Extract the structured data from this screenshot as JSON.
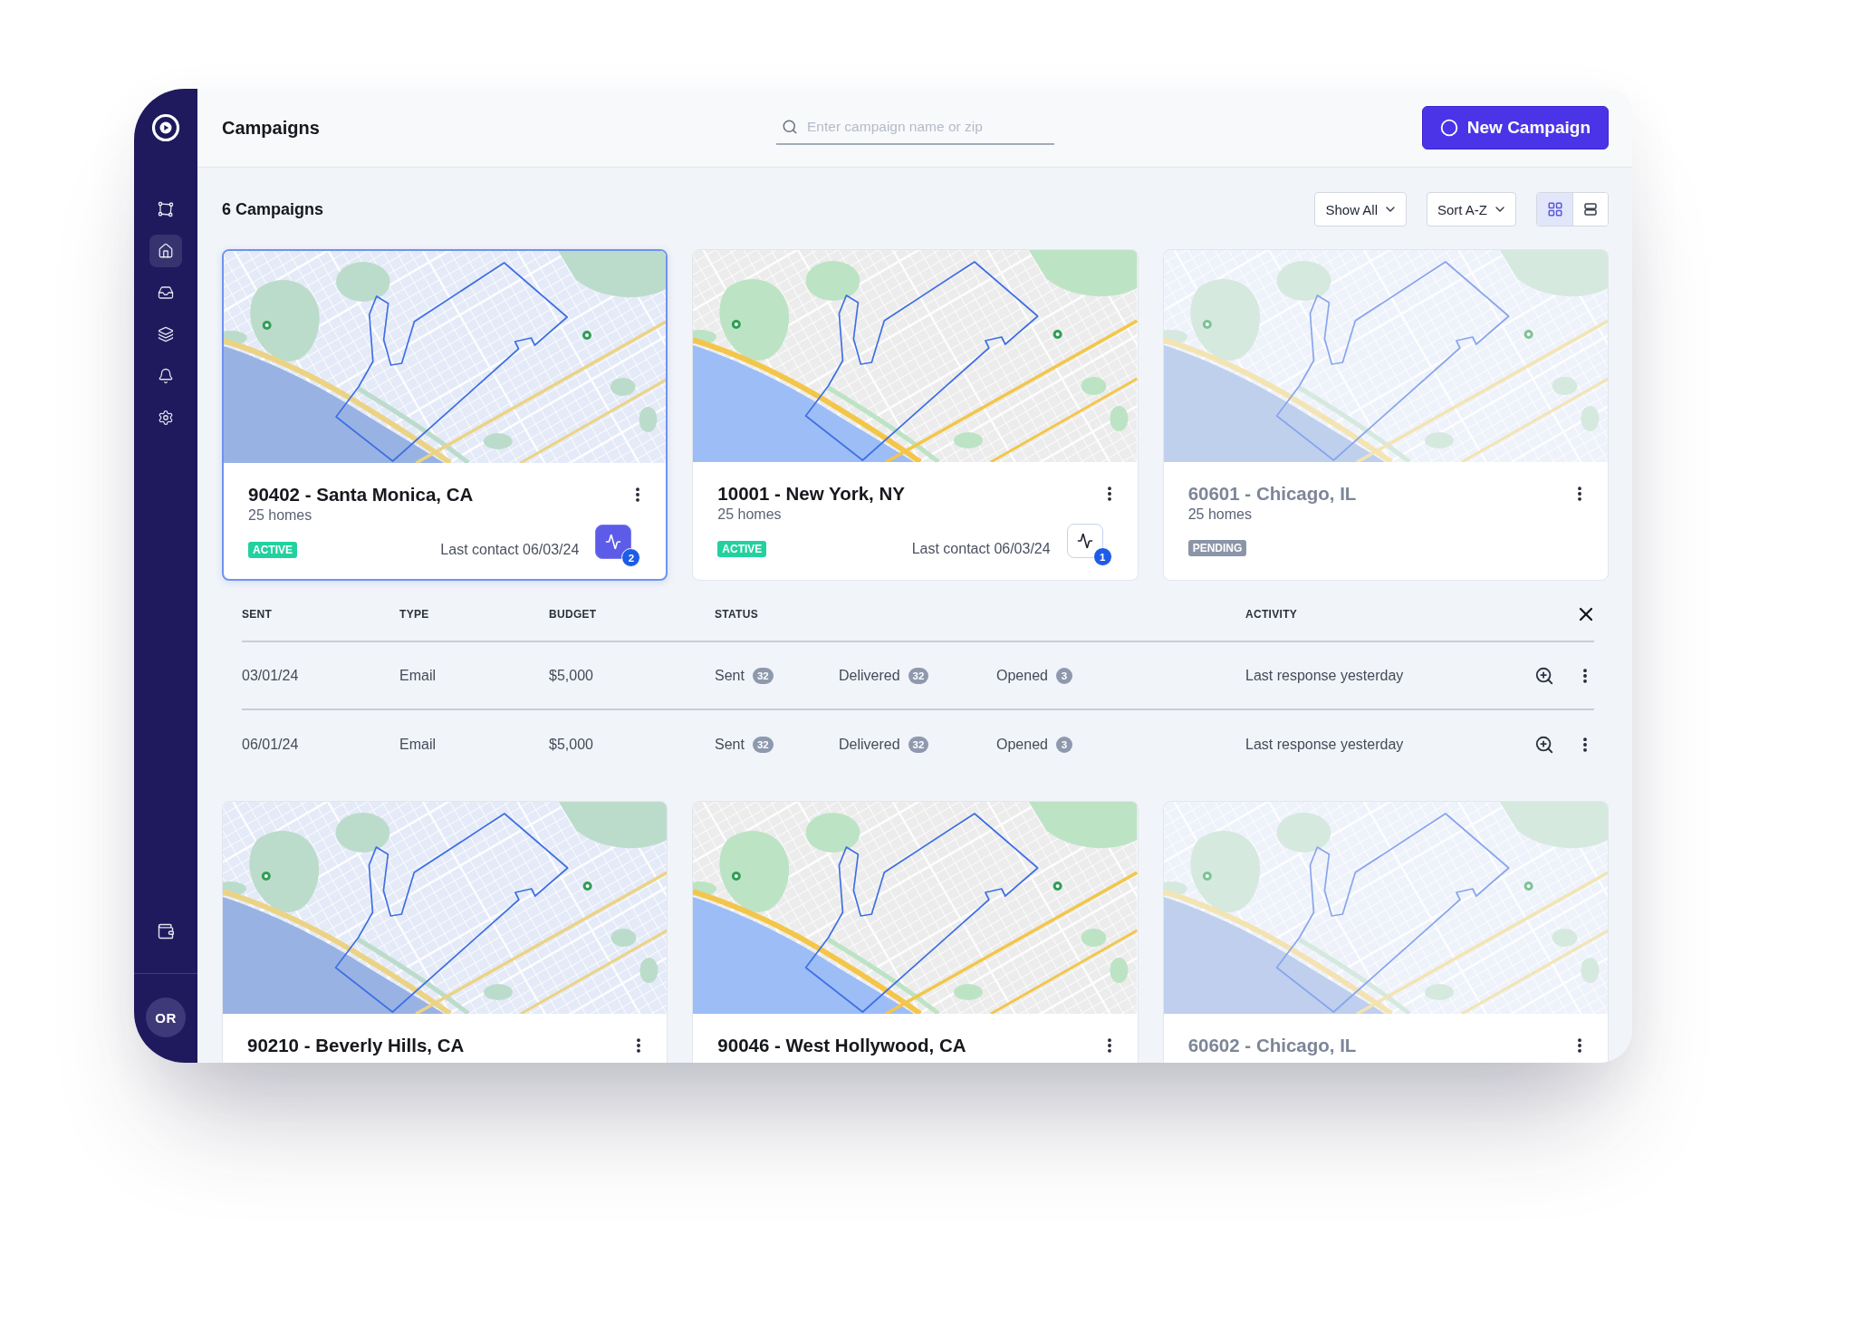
{
  "sidebar": {
    "items": [
      {
        "selected": false
      },
      {
        "selected": true
      },
      {
        "selected": false
      },
      {
        "selected": false
      },
      {
        "selected": false
      },
      {
        "selected": false
      }
    ],
    "avatar": "OR"
  },
  "header": {
    "title": "Campaigns",
    "search": {
      "placeholder": "Enter campaign name or zip"
    },
    "new_button": "New Campaign"
  },
  "toolbar": {
    "count": "6 Campaigns",
    "filter": "Show All",
    "sort": "Sort A-Z",
    "views": [
      {
        "selected": true
      },
      {
        "selected": false
      }
    ]
  },
  "campaigns_top": [
    {
      "title": "90402 - Santa Monica, CA",
      "homes": "25 homes",
      "status": {
        "label": "ACTIVE",
        "kind": "active"
      },
      "last_contact": "Last contact 06/03/24",
      "activity": {
        "count": "2",
        "highlighted": true
      },
      "selected": true,
      "dimmed": false,
      "map_tinted": true
    },
    {
      "title": "10001 - New York, NY",
      "homes": "25 homes",
      "status": {
        "label": "ACTIVE",
        "kind": "active"
      },
      "last_contact": "Last contact 06/03/24",
      "activity": {
        "count": "1",
        "highlighted": false
      },
      "selected": false,
      "dimmed": false,
      "map_tinted": false
    },
    {
      "title": "60601 - Chicago, IL",
      "homes": "25 homes",
      "status": {
        "label": "PENDING",
        "kind": "pending"
      },
      "selected": false,
      "dimmed": true,
      "map_tinted": true
    }
  ],
  "details": {
    "columns": [
      "SENT",
      "TYPE",
      "BUDGET",
      "STATUS",
      "ACTIVITY"
    ],
    "rows": [
      {
        "sent": "03/01/24",
        "type": "Email",
        "budget": "$5,000",
        "statuses": [
          {
            "label": "Sent",
            "count": "32"
          },
          {
            "label": "Delivered",
            "count": "32"
          },
          {
            "label": "Opened",
            "count": "3"
          }
        ],
        "activity": "Last response yesterday"
      },
      {
        "sent": "06/01/24",
        "type": "Email",
        "budget": "$5,000",
        "statuses": [
          {
            "label": "Sent",
            "count": "32"
          },
          {
            "label": "Delivered",
            "count": "32"
          },
          {
            "label": "Opened",
            "count": "3"
          }
        ],
        "activity": "Last response yesterday"
      }
    ]
  },
  "campaigns_bottom": [
    {
      "title": "90210 - Beverly Hills, CA",
      "selected": false,
      "dimmed": false,
      "map_tinted": true
    },
    {
      "title": "90046 - West Hollywood, CA",
      "selected": false,
      "dimmed": false,
      "map_tinted": false
    },
    {
      "title": "60602 - Chicago, IL",
      "selected": false,
      "dimmed": true,
      "map_tinted": true
    }
  ]
}
